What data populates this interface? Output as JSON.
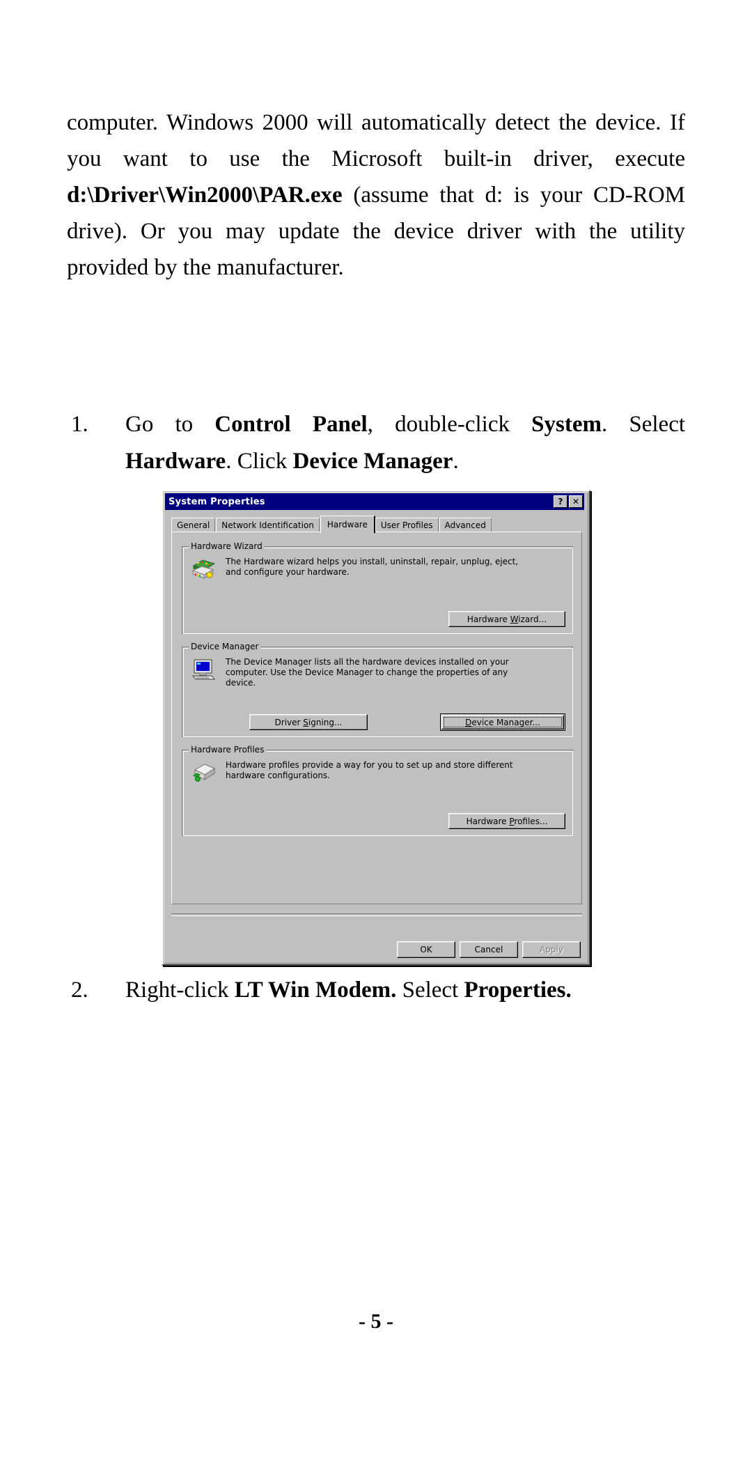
{
  "document": {
    "paragraph": {
      "segments": [
        {
          "text": "computer.  Windows 2000 will automatically detect the device.  If you want to use the Microsoft built-in driver, execute ",
          "bold": false
        },
        {
          "text": "d:\\Driver\\Win2000\\PAR.exe",
          "bold": true
        },
        {
          "text": " (assume that d: is your CD-ROM drive).  Or you may update the device driver with the utility provided by the manufacturer.",
          "bold": false
        }
      ]
    },
    "steps": [
      {
        "number": "1.",
        "segments": [
          {
            "text": "Go to ",
            "bold": false
          },
          {
            "text": "Control Panel",
            "bold": true
          },
          {
            "text": ", double-click ",
            "bold": false
          },
          {
            "text": "System",
            "bold": true
          },
          {
            "text": ".  Select ",
            "bold": false
          },
          {
            "text": "Hardware",
            "bold": true
          },
          {
            "text": ". Click ",
            "bold": false
          },
          {
            "text": "Device Manager",
            "bold": true
          },
          {
            "text": ".",
            "bold": false
          }
        ]
      },
      {
        "number": "2.",
        "segments": [
          {
            "text": "Right-click ",
            "bold": false
          },
          {
            "text": "LT Win Modem.",
            "bold": true
          },
          {
            "text": "  Select ",
            "bold": false
          },
          {
            "text": "Properties.",
            "bold": true
          }
        ]
      }
    ],
    "page_number": "- 5 -"
  },
  "dialog": {
    "title": "System Properties",
    "titlebar_buttons": [
      {
        "name": "help-button",
        "glyph": "?"
      },
      {
        "name": "close-button",
        "glyph": "✕"
      }
    ],
    "tabs": [
      {
        "label": "General",
        "active": false
      },
      {
        "label": "Network Identification",
        "active": false
      },
      {
        "label": "Hardware",
        "active": true
      },
      {
        "label": "User Profiles",
        "active": false
      },
      {
        "label": "Advanced",
        "active": false
      }
    ],
    "groups": [
      {
        "title": "Hardware Wizard",
        "icon": "hardware-wizard-icon",
        "description": "The Hardware wizard helps you install, uninstall, repair, unplug, eject, and configure your hardware.",
        "buttons": [
          {
            "label_pre": "Hardware ",
            "label_accel": "W",
            "label_post": "izard...",
            "name": "hardware-wizard-button",
            "default": false
          }
        ]
      },
      {
        "title": "Device Manager",
        "icon": "device-manager-icon",
        "description": "The Device Manager lists all the hardware devices installed on your computer. Use the Device Manager to change the properties of any device.",
        "buttons": [
          {
            "label_pre": "Driver ",
            "label_accel": "S",
            "label_post": "igning...",
            "name": "driver-signing-button",
            "default": false
          },
          {
            "label_pre": "",
            "label_accel": "D",
            "label_post": "evice Manager...",
            "name": "device-manager-button",
            "default": true
          }
        ]
      },
      {
        "title": "Hardware Profiles",
        "icon": "hardware-profiles-icon",
        "description": "Hardware profiles provide a way for you to set up and store different hardware configurations.",
        "buttons": [
          {
            "label_pre": "Hardware ",
            "label_accel": "P",
            "label_post": "rofiles...",
            "name": "hardware-profiles-button",
            "default": false
          }
        ]
      }
    ],
    "footer_buttons": [
      {
        "label": "OK",
        "name": "ok-button",
        "disabled": false
      },
      {
        "label": "Cancel",
        "name": "cancel-button",
        "disabled": false
      },
      {
        "label": "Apply",
        "name": "apply-button",
        "disabled": true
      }
    ],
    "colors": {
      "titlebar": "#00007f",
      "face": "#c0c0c0",
      "shadow": "#808080",
      "highlight": "#ffffff"
    }
  }
}
